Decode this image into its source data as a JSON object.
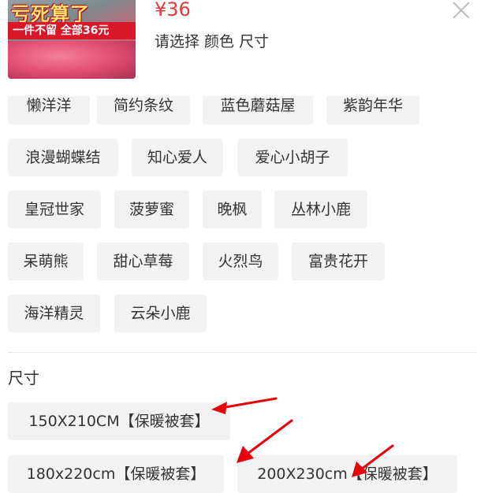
{
  "product": {
    "thumb_text_main": "亏死算了",
    "thumb_text_sub": "一件不留 全部36元",
    "price": "¥36",
    "select_hint": "请选择 颜色 尺寸"
  },
  "color_options": [
    "懒洋洋",
    "简约条纹",
    "蓝色蘑菇屋",
    "紫韵年华",
    "浪漫蝴蝶结",
    "知心爱人",
    "爱心小胡子",
    "皇冠世家",
    "菠萝蜜",
    "晚枫",
    "丛林小鹿",
    "呆萌熊",
    "甜心草莓",
    "火烈鸟",
    "富贵花开",
    "海洋精灵",
    "云朵小鹿"
  ],
  "size_section": {
    "title": "尺寸",
    "options": [
      "150X210CM【保暖被套】",
      "180x220cm【保暖被套】",
      "200X230cm【保暖被套】"
    ]
  },
  "colors": {
    "price_red": "#e4393c",
    "chip_bg": "#f2f2f2",
    "annotation_red": "#e8000b"
  },
  "icons": {
    "close": "close-icon"
  }
}
